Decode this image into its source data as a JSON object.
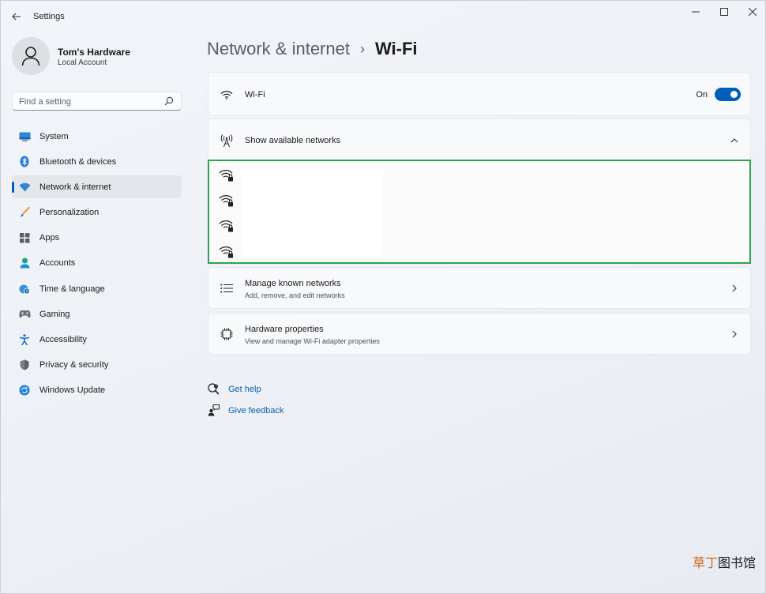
{
  "window": {
    "title": "Settings",
    "controls": [
      "minimize",
      "maximize",
      "close"
    ]
  },
  "profile": {
    "name": "Tom's Hardware",
    "subtitle": "Local Account"
  },
  "search": {
    "placeholder": "Find a setting",
    "value": ""
  },
  "sidebar": {
    "items": [
      {
        "label": "System",
        "icon": "system-icon",
        "active": false
      },
      {
        "label": "Bluetooth & devices",
        "icon": "bluetooth-icon",
        "active": false
      },
      {
        "label": "Network & internet",
        "icon": "network-icon",
        "active": true
      },
      {
        "label": "Personalization",
        "icon": "brush-icon",
        "active": false
      },
      {
        "label": "Apps",
        "icon": "apps-icon",
        "active": false
      },
      {
        "label": "Accounts",
        "icon": "accounts-icon",
        "active": false
      },
      {
        "label": "Time & language",
        "icon": "globe-clock-icon",
        "active": false
      },
      {
        "label": "Gaming",
        "icon": "gamepad-icon",
        "active": false
      },
      {
        "label": "Accessibility",
        "icon": "accessibility-icon",
        "active": false
      },
      {
        "label": "Privacy & security",
        "icon": "shield-icon",
        "active": false
      },
      {
        "label": "Windows Update",
        "icon": "update-icon",
        "active": false
      }
    ]
  },
  "breadcrumb": {
    "parent": "Network & internet",
    "separator": "›",
    "current": "Wi-Fi"
  },
  "wifi": {
    "label": "Wi-Fi",
    "toggle_label": "On",
    "enabled": true
  },
  "available_networks": {
    "label": "Show available networks",
    "expanded": true,
    "network_count": 4
  },
  "known_networks": {
    "title": "Manage known networks",
    "subtitle": "Add, remove, and edit networks"
  },
  "hardware": {
    "title": "Hardware properties",
    "subtitle": "View and manage Wi-Fi adapter properties"
  },
  "links": {
    "help": "Get help",
    "feedback": "Give feedback"
  },
  "watermark": {
    "part1": "草丁",
    "part2": "图书馆"
  },
  "colors": {
    "accent": "#005fb8",
    "highlight_border": "#2da44e",
    "link": "#0a5fa8"
  }
}
